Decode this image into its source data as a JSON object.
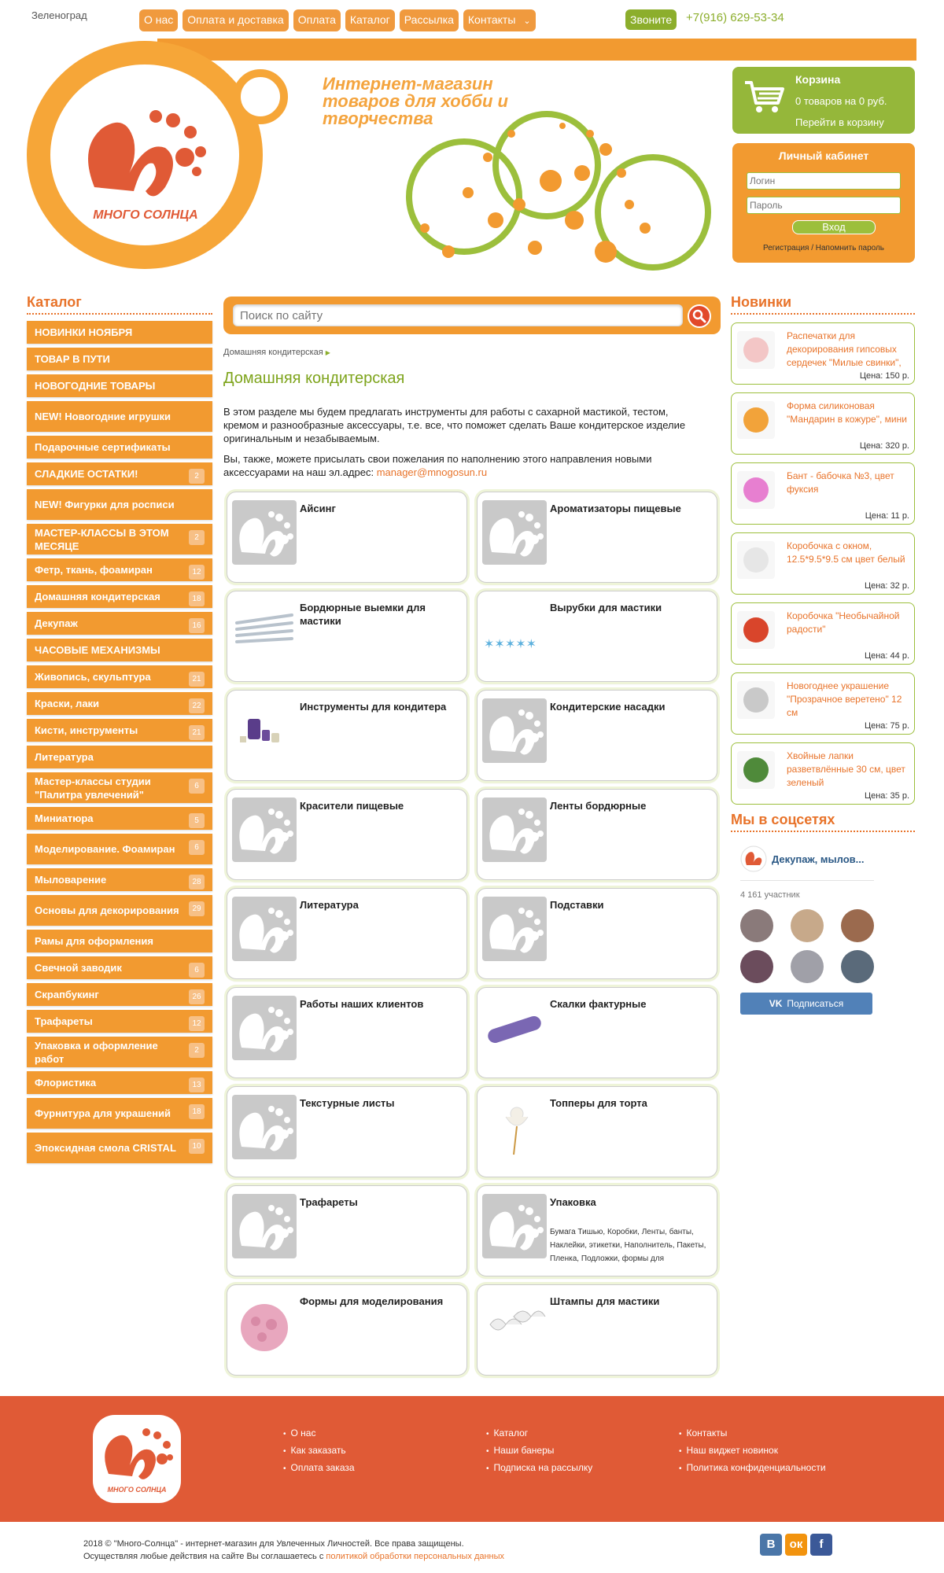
{
  "topbar": {
    "city": "Зеленоград",
    "nav": [
      "О нас",
      "Оплата и доставка",
      "Оплата",
      "Каталог",
      "Рассылка",
      "Контакты"
    ],
    "call_label": "Звоните",
    "phone": "+7(916) 629-53-34"
  },
  "header": {
    "logo_text": "МНОГО СОЛНЦА",
    "slogan": "Интернет-магазин товаров для хобби и творчества"
  },
  "cart": {
    "title": "Корзина",
    "info": "0 товаров на 0 руб.",
    "link": "Перейти в корзину"
  },
  "cabinet": {
    "title": "Личный кабинет",
    "login_placeholder": "Логин",
    "password_placeholder": "Пароль",
    "enter_label": "Вход",
    "register": "Регистрация / Напомнить пароль"
  },
  "catalog": {
    "title": "Каталог",
    "items": [
      {
        "label": "НОВИНКИ НОЯБРЯ",
        "count": ""
      },
      {
        "label": "ТОВАР В ПУТИ",
        "count": ""
      },
      {
        "label": "НОВОГОДНИЕ ТОВАРЫ",
        "count": ""
      },
      {
        "label": "NEW! Новогодние игрушки",
        "count": ""
      },
      {
        "label": "Подарочные сертификаты",
        "count": ""
      },
      {
        "label": "СЛАДКИЕ ОСТАТКИ!",
        "count": "2"
      },
      {
        "label": "NEW! Фигурки для росписи",
        "count": ""
      },
      {
        "label": "МАСТЕР-КЛАССЫ В ЭТОМ МЕСЯЦЕ",
        "count": "2"
      },
      {
        "label": "Фетр, ткань, фоамиран",
        "count": "12"
      },
      {
        "label": "Домашняя кондитерская",
        "count": "18"
      },
      {
        "label": "Декупаж",
        "count": "16"
      },
      {
        "label": "ЧАСОВЫЕ МЕХАНИЗМЫ",
        "count": ""
      },
      {
        "label": "Живопись, скульптура",
        "count": "21"
      },
      {
        "label": "Краски, лаки",
        "count": "22"
      },
      {
        "label": "Кисти, инструменты",
        "count": "21"
      },
      {
        "label": "Литература",
        "count": ""
      },
      {
        "label": "Мастер-классы студии \"Палитра увлечений\"",
        "count": "6"
      },
      {
        "label": "Миниатюра",
        "count": "5"
      },
      {
        "label": "Моделирование. Фоамиран",
        "count": "6"
      },
      {
        "label": "Мыловарение",
        "count": "28"
      },
      {
        "label": "Основы для декорирования",
        "count": "29"
      },
      {
        "label": "Рамы для оформления",
        "count": ""
      },
      {
        "label": "Свечной заводик",
        "count": "6"
      },
      {
        "label": "Скрапбукинг",
        "count": "26"
      },
      {
        "label": "Трафареты",
        "count": "12"
      },
      {
        "label": "Упаковка и оформление работ",
        "count": "2"
      },
      {
        "label": "Флористика",
        "count": "13"
      },
      {
        "label": "Фурнитура для украшений",
        "count": "18"
      },
      {
        "label": "Эпоксидная смола CRISTAL",
        "count": "10"
      }
    ]
  },
  "search": {
    "placeholder": "Поиск по сайту"
  },
  "breadcrumb": "Домашняя кондитерская",
  "page": {
    "title": "Домашняя кондитерская",
    "p1": "В этом разделе мы будем предлагать инструменты для работы с сахарной мастикой, тестом, кремом и разнообразные аксессуары,  т.е. все, что поможет сделать Ваше кондитерское изделие оригинальным и незабываемым.",
    "p2": "Вы, также, можете присылать свои пожелания по наполнению этого направления новыми аксессуарами на наш эл.адрес:",
    "email": "manager@mnogosun.ru"
  },
  "categories": [
    {
      "name": "Айсинг",
      "thumb": "logo",
      "sub": ""
    },
    {
      "name": "Ароматизаторы пищевые",
      "thumb": "logo",
      "sub": ""
    },
    {
      "name": "Бордюрные выемки для мастики",
      "thumb": "sticks",
      "sub": ""
    },
    {
      "name": "Вырубки для мастики",
      "thumb": "stars",
      "sub": ""
    },
    {
      "name": "Инструменты для кондитера",
      "thumb": "tools",
      "sub": ""
    },
    {
      "name": "Кондитерские насадки",
      "thumb": "logo",
      "sub": ""
    },
    {
      "name": "Красители пищевые",
      "thumb": "logo",
      "sub": ""
    },
    {
      "name": "Ленты бордюрные",
      "thumb": "logo",
      "sub": ""
    },
    {
      "name": "Литература",
      "thumb": "logo",
      "sub": ""
    },
    {
      "name": "Подставки",
      "thumb": "logo",
      "sub": ""
    },
    {
      "name": "Работы наших клиентов",
      "thumb": "logo",
      "sub": ""
    },
    {
      "name": "Скалки фактурные",
      "thumb": "roller",
      "sub": ""
    },
    {
      "name": "Текстурные листы",
      "thumb": "logo",
      "sub": ""
    },
    {
      "name": "Топперы для торта",
      "thumb": "angel",
      "sub": ""
    },
    {
      "name": "Трафареты",
      "thumb": "logo",
      "sub": ""
    },
    {
      "name": "Упаковка",
      "thumb": "logo",
      "sub": "Бумага Тишью, Коробки, Ленты, банты, Наклейки, этикетки, Наполнитель, Пакеты, Пленка, Подложки, формы для"
    },
    {
      "name": "Формы для моделирования",
      "thumb": "mold",
      "sub": ""
    },
    {
      "name": "Штампы для мастики",
      "thumb": "bows",
      "sub": ""
    }
  ],
  "news": {
    "title": "Новинки",
    "items": [
      {
        "name": "Распечатки для декорирования гипсовых сердечек \"Милые свинки\",",
        "price": "Цена: 150 р.",
        "color": "#f3c6c6"
      },
      {
        "name": "Форма силиконовая \"Мандарин в кожуре\", мини",
        "price": "Цена: 320 р.",
        "color": "#f2a33a"
      },
      {
        "name": "Бант - бабочка №3, цвет фуксия",
        "price": "Цена: 11 р.",
        "color": "#e77fd0"
      },
      {
        "name": "Коробочка с окном, 12.5*9.5*9.5 см цвет белый",
        "price": "Цена: 32 р.",
        "color": "#e6e6e6"
      },
      {
        "name": "Коробочка \"Необычайной радости\"",
        "price": "Цена: 44 р.",
        "color": "#d9452b"
      },
      {
        "name": "Новогоднее украшение \"Прозрачное веретено\" 12 см",
        "price": "Цена: 75 р.",
        "color": "#c9c9c9"
      },
      {
        "name": "Хвойные лапки разветвлённые 30 см, цвет зеленый",
        "price": "Цена: 35 р.",
        "color": "#4f8a3a"
      }
    ]
  },
  "social_block": {
    "title": "Мы в соцсетях",
    "group": "Декупаж, мылов...",
    "members": "4 161 участник",
    "subscribe": "Подписаться",
    "avatar_colors": [
      "#8a7a7a",
      "#c7a98a",
      "#9b6a4e",
      "#6b4c5c",
      "#a0a0a8",
      "#5a6a7a"
    ]
  },
  "footer": {
    "col1": [
      "О нас",
      "Как заказать",
      "Оплата заказа"
    ],
    "col2": [
      "Каталог",
      "Наши банеры",
      "Подписка на рассылку"
    ],
    "col3": [
      "Контакты",
      "Наш виджет новинок",
      "Политика конфиденциальности"
    ],
    "copy1": "2018 © \"Много-Солнца\" - интернет-магазин для Увлеченных Личностей. Все права защищены.",
    "copy2": "Осуществляя любые действия на сайте Вы соглашаетесь с",
    "policy": "политикой обработки персональных данных",
    "social": [
      {
        "label": "В",
        "color": "#4a76a8"
      },
      {
        "label": "ок",
        "color": "#f2930e"
      },
      {
        "label": "f",
        "color": "#3b5998"
      }
    ]
  },
  "colors": {
    "orange": "#f29a30",
    "green": "#95b73a",
    "red": "#e05a36"
  }
}
